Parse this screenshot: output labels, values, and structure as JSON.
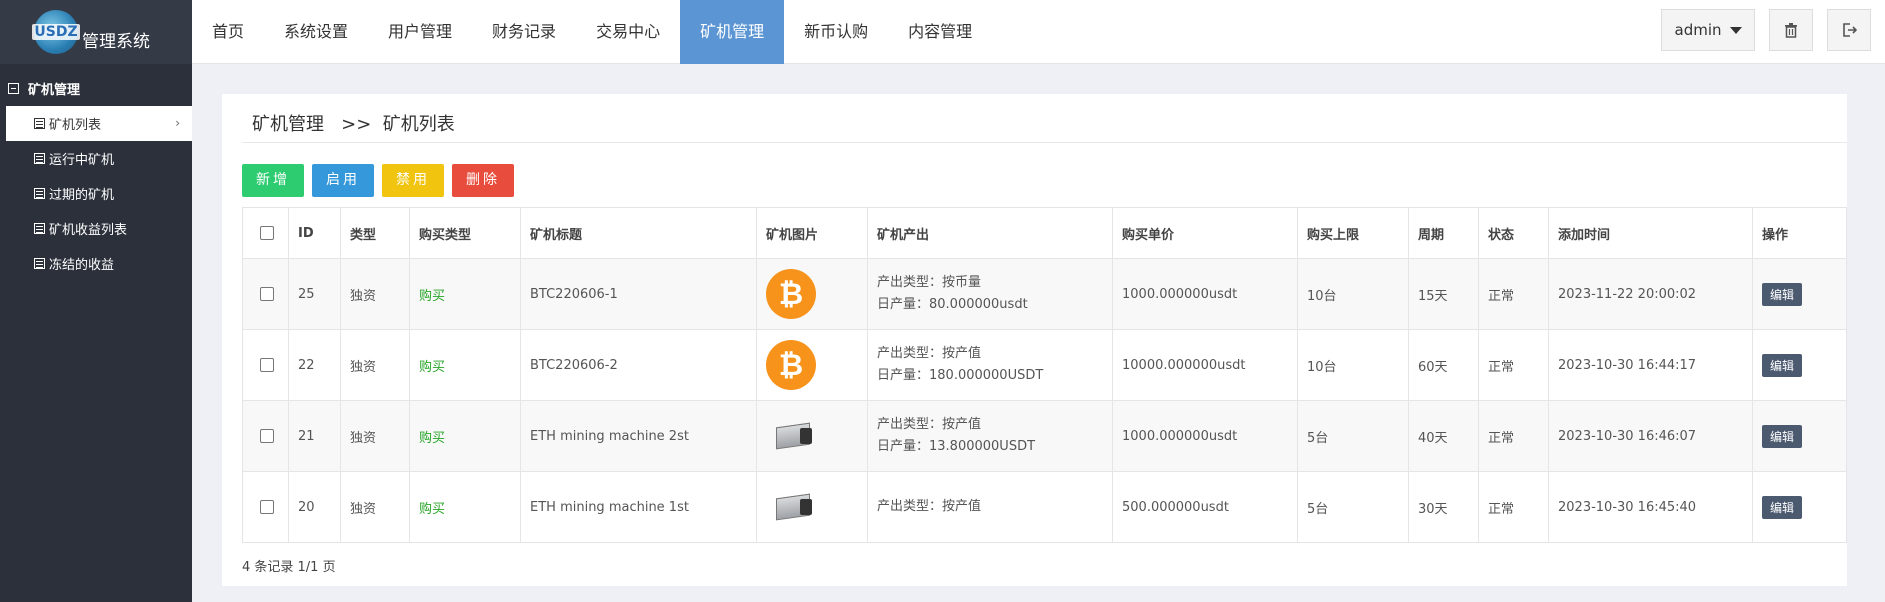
{
  "app": {
    "logo_text": "USDZ",
    "title": "管理系统"
  },
  "topnav": [
    {
      "label": "首页"
    },
    {
      "label": "系统设置"
    },
    {
      "label": "用户管理"
    },
    {
      "label": "财务记录"
    },
    {
      "label": "交易中心"
    },
    {
      "label": "矿机管理",
      "active": true
    },
    {
      "label": "新币认购"
    },
    {
      "label": "内容管理"
    }
  ],
  "user": {
    "name": "admin"
  },
  "sidebar": {
    "group": "矿机管理",
    "items": [
      {
        "label": "矿机列表",
        "active": true
      },
      {
        "label": "运行中矿机"
      },
      {
        "label": "过期的矿机"
      },
      {
        "label": "矿机收益列表"
      },
      {
        "label": "冻结的收益"
      }
    ]
  },
  "breadcrumb": {
    "parent": "矿机管理",
    "sep": ">>",
    "current": "矿机列表"
  },
  "actions": {
    "add": "新增",
    "enable": "启用",
    "disable": "禁用",
    "delete": "删除"
  },
  "table": {
    "headers": [
      "ID",
      "类型",
      "购买类型",
      "矿机标题",
      "矿机图片",
      "矿机产出",
      "购买单价",
      "购买上限",
      "周期",
      "状态",
      "添加时间",
      "操作"
    ],
    "rows": [
      {
        "id": "25",
        "type": "独资",
        "buy_type": "购买",
        "title": "BTC220606-1",
        "image": "bitcoin-coin",
        "output_type": "产出类型：按币量",
        "daily": "日产量：80.000000usdt",
        "price": "1000.000000usdt",
        "limit": "10台",
        "cycle": "15天",
        "status": "正常",
        "time": "2023-11-22 20:00:02",
        "action": "编辑"
      },
      {
        "id": "22",
        "type": "独资",
        "buy_type": "购买",
        "title": "BTC220606-2",
        "image": "bitcoin-coin",
        "output_type": "产出类型：按产值",
        "daily": "日产量：180.000000USDT",
        "price": "10000.000000usdt",
        "limit": "10台",
        "cycle": "60天",
        "status": "正常",
        "time": "2023-10-30 16:44:17",
        "action": "编辑"
      },
      {
        "id": "21",
        "type": "独资",
        "buy_type": "购买",
        "title": "ETH mining machine 2st",
        "image": "miner-device",
        "output_type": "产出类型：按产值",
        "daily": "日产量：13.800000USDT",
        "price": "1000.000000usdt",
        "limit": "5台",
        "cycle": "40天",
        "status": "正常",
        "time": "2023-10-30 16:46:07",
        "action": "编辑"
      },
      {
        "id": "20",
        "type": "独资",
        "buy_type": "购买",
        "title": "ETH mining machine 1st",
        "image": "miner-device",
        "output_type": "产出类型：按产值",
        "daily": "",
        "price": "500.000000usdt",
        "limit": "5台",
        "cycle": "30天",
        "status": "正常",
        "time": "2023-10-30 16:45:40",
        "action": "编辑"
      }
    ]
  },
  "footer": {
    "summary": "4 条记录 1/1 页"
  }
}
